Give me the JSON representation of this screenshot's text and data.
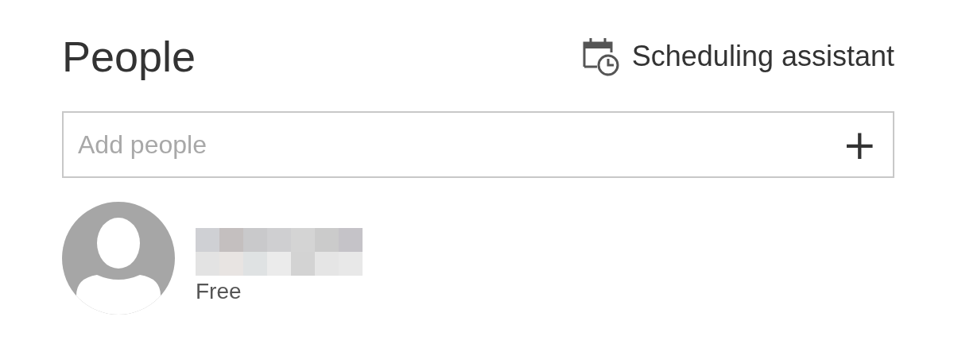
{
  "title": "People",
  "scheduling_assistant": {
    "label": "Scheduling assistant"
  },
  "add_people": {
    "placeholder": "Add people",
    "button": "+"
  },
  "attendees": [
    {
      "availability": "Free"
    }
  ]
}
